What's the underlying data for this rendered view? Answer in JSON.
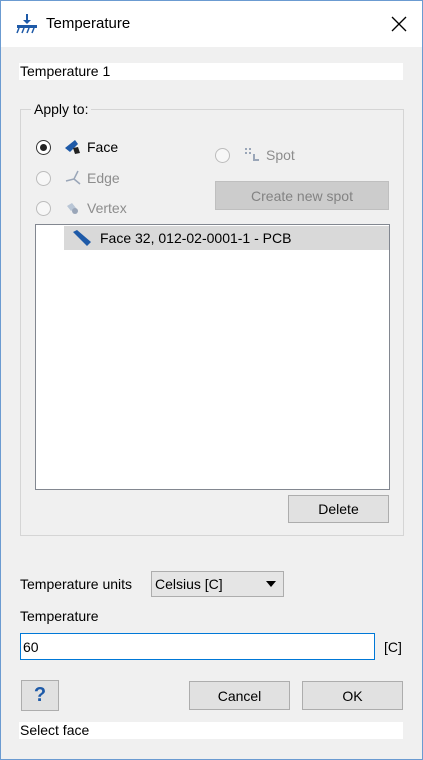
{
  "window": {
    "title": "Temperature",
    "title_icon": "temperature-bc-icon",
    "close_icon": "close-icon"
  },
  "name_field": {
    "value": "Temperature 1"
  },
  "apply_to": {
    "title": "Apply to:",
    "options": [
      {
        "label": "Face",
        "icon": "face-icon",
        "checked": true,
        "enabled": true
      },
      {
        "label": "Edge",
        "icon": "edge-icon",
        "checked": false,
        "enabled": false
      },
      {
        "label": "Vertex",
        "icon": "vertex-icon",
        "checked": false,
        "enabled": false
      },
      {
        "label": "Spot",
        "icon": "spot-icon",
        "checked": false,
        "enabled": false
      }
    ],
    "create_spot_label": "Create new spot",
    "selection_list": [
      {
        "label": "Face 32, 012-02-0001-1 - PCB",
        "icon": "face-icon"
      }
    ],
    "delete_label": "Delete"
  },
  "units": {
    "label": "Temperature units",
    "selected": "Celsius [C]"
  },
  "temperature": {
    "label": "Temperature",
    "value": "60",
    "unit": "[C]"
  },
  "buttons": {
    "help": "?",
    "cancel": "Cancel",
    "ok": "OK"
  },
  "status": {
    "text": "Select face"
  },
  "colors": {
    "accent": "#0078d7",
    "selection": "#d9d9d9",
    "face_icon": "#1e5aa8"
  }
}
